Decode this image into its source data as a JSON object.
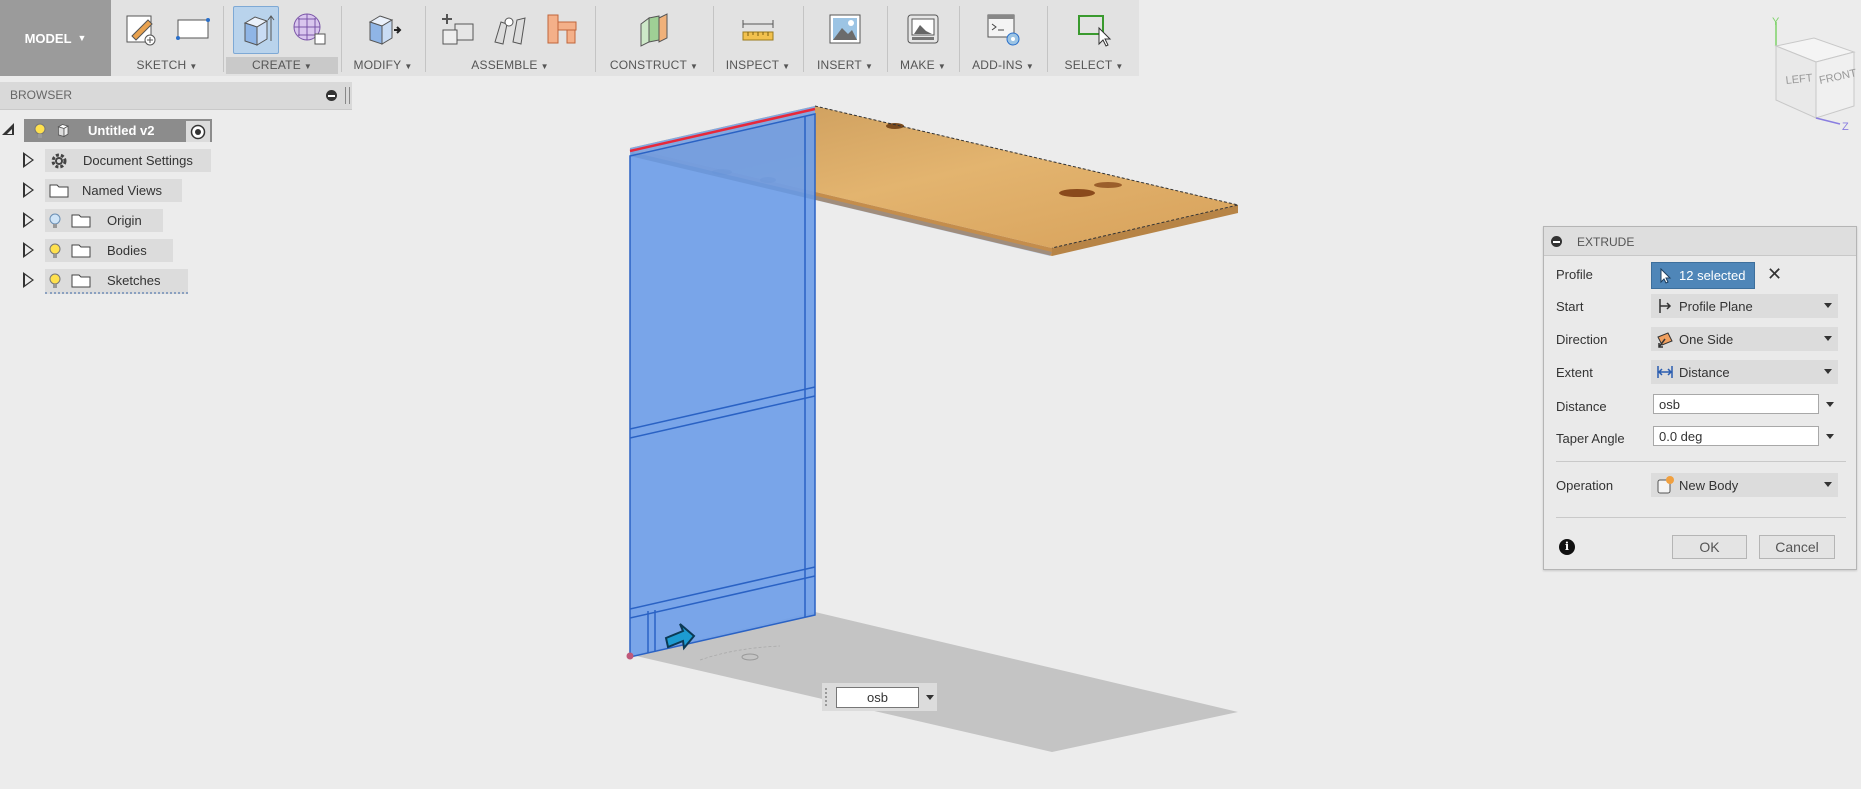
{
  "toolbar": {
    "model_label": "MODEL",
    "groups": [
      {
        "label": "SKETCH",
        "icons": [
          "create-sketch-icon",
          "rectangle-icon"
        ]
      },
      {
        "label": "CREATE",
        "icons": [
          "extrude-icon",
          "form-icon"
        ]
      },
      {
        "label": "MODIFY",
        "icons": [
          "press-pull-icon"
        ]
      },
      {
        "label": "ASSEMBLE",
        "icons": [
          "new-component-icon",
          "joint-icon",
          "as-built-joint-icon"
        ]
      },
      {
        "label": "CONSTRUCT",
        "icons": [
          "offset-plane-icon"
        ]
      },
      {
        "label": "INSPECT",
        "icons": [
          "measure-icon"
        ]
      },
      {
        "label": "INSERT",
        "icons": [
          "insert-image-icon"
        ]
      },
      {
        "label": "MAKE",
        "icons": [
          "3d-print-icon"
        ]
      },
      {
        "label": "ADD-INS",
        "icons": [
          "scripts-addins-icon"
        ]
      },
      {
        "label": "SELECT",
        "icons": [
          "select-icon"
        ]
      }
    ]
  },
  "browser": {
    "title": "BROWSER",
    "root": "Untitled v2",
    "items": [
      {
        "label": "Document Settings",
        "icon": "gear-icon"
      },
      {
        "label": "Named Views",
        "icon": "folder-icon"
      },
      {
        "label": "Origin",
        "icon": "folder-icon"
      },
      {
        "label": "Bodies",
        "icon": "folder-icon"
      },
      {
        "label": "Sketches",
        "icon": "folder-icon"
      }
    ]
  },
  "viewcube": {
    "left": "LEFT",
    "front": "FRONT",
    "axis_y": "Y",
    "axis_z": "Z"
  },
  "extrude": {
    "title": "EXTRUDE",
    "profile_label": "Profile",
    "profile_value": "12 selected",
    "start_label": "Start",
    "start_value": "Profile Plane",
    "direction_label": "Direction",
    "direction_value": "One Side",
    "extent_label": "Extent",
    "extent_value": "Distance",
    "distance_label": "Distance",
    "distance_value": "osb",
    "taper_label": "Taper Angle",
    "taper_value": "0.0 deg",
    "operation_label": "Operation",
    "operation_value": "New Body",
    "ok_label": "OK",
    "cancel_label": "Cancel"
  },
  "canvas_input": {
    "value": "osb"
  },
  "colors": {
    "selection": "#6f9ee8",
    "wood": "#d9a55c",
    "accent": "#4f86b8"
  }
}
